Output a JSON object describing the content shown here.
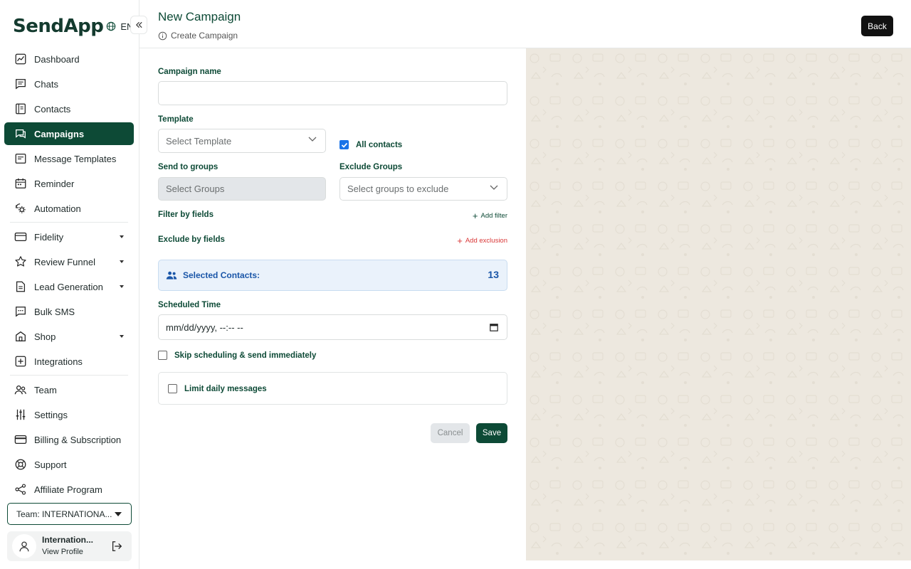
{
  "app": {
    "logo": "SendApp",
    "language": "EN"
  },
  "sidebar": {
    "items": [
      {
        "label": "Dashboard",
        "icon": "dashboard-icon"
      },
      {
        "label": "Chats",
        "icon": "chat-icon"
      },
      {
        "label": "Contacts",
        "icon": "contacts-icon"
      },
      {
        "label": "Campaigns",
        "icon": "campaign-icon",
        "active": true
      },
      {
        "label": "Message Templates",
        "icon": "template-icon"
      },
      {
        "label": "Reminder",
        "icon": "calendar-icon"
      },
      {
        "label": "Automation",
        "icon": "automation-icon"
      },
      {
        "label": "Fidelity",
        "icon": "card-icon",
        "caret": true
      },
      {
        "label": "Review Funnel",
        "icon": "star-icon",
        "caret": true
      },
      {
        "label": "Lead Generation",
        "icon": "document-icon",
        "caret": true
      },
      {
        "label": "Bulk SMS",
        "icon": "sms-icon"
      },
      {
        "label": "Shop",
        "icon": "shop-icon",
        "caret": true
      },
      {
        "label": "Integrations",
        "icon": "plus-square-icon"
      },
      {
        "label": "Team",
        "icon": "team-icon"
      },
      {
        "label": "Settings",
        "icon": "settings-sliders-icon"
      },
      {
        "label": "Billing & Subscription",
        "icon": "billing-card-icon"
      },
      {
        "label": "Support",
        "icon": "support-icon"
      },
      {
        "label": "Affiliate Program",
        "icon": "share-icon"
      }
    ],
    "team_select": "Team: INTERNATIONA...",
    "profile": {
      "name": "Internation...",
      "link": "View Profile"
    }
  },
  "header": {
    "title": "New Campaign",
    "subtitle": "Create Campaign",
    "back_label": "Back"
  },
  "form": {
    "campaign_name_label": "Campaign name",
    "campaign_name_value": "",
    "template_label": "Template",
    "template_placeholder": "Select Template",
    "all_contacts_label": "All contacts",
    "all_contacts_checked": true,
    "send_groups_label": "Send to groups",
    "send_groups_placeholder": "Select Groups",
    "exclude_groups_label": "Exclude Groups",
    "exclude_groups_placeholder": "Select groups to exclude",
    "filter_label": "Filter by fields",
    "add_filter": "Add filter",
    "exclude_label": "Exclude by fields",
    "add_exclusion": "Add exclusion",
    "selected_contacts_label": "Selected Contacts:",
    "selected_contacts_count": "13",
    "scheduled_label": "Scheduled Time",
    "scheduled_placeholder": "mm/dd/yyyy, --:-- --",
    "skip_label": "Skip scheduling & send immediately",
    "limit_label": "Limit daily messages",
    "cancel_label": "Cancel",
    "save_label": "Save"
  },
  "colors": {
    "brand": "#0d4a36",
    "accent_blue": "#1a56a8",
    "add_exclusion": "#d93636",
    "panel_bg": "#ede8df"
  }
}
